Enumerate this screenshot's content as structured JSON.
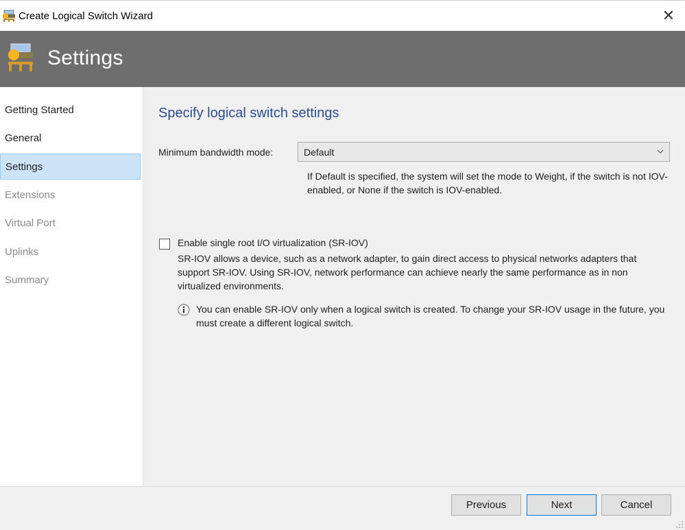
{
  "window": {
    "title": "Create Logical Switch Wizard"
  },
  "banner": {
    "title": "Settings"
  },
  "nav": {
    "items": [
      {
        "label": "Getting Started",
        "state": "done"
      },
      {
        "label": "General",
        "state": "done"
      },
      {
        "label": "Settings",
        "state": "active"
      },
      {
        "label": "Extensions",
        "state": "pending"
      },
      {
        "label": "Virtual Port",
        "state": "pending"
      },
      {
        "label": "Uplinks",
        "state": "pending"
      },
      {
        "label": "Summary",
        "state": "pending"
      }
    ]
  },
  "main": {
    "heading": "Specify logical switch settings",
    "bandwidth": {
      "label": "Minimum bandwidth mode:",
      "value": "Default",
      "help": "If Default is specified, the system will set the mode to Weight, if the switch is not IOV-enabled, or None if the switch is IOV-enabled."
    },
    "sriov": {
      "label": "Enable single root I/O virtualization (SR-IOV)",
      "checked": false,
      "description": "SR-IOV allows a device, such as a network adapter, to gain direct access to physical networks adapters that support SR-IOV. Using SR-IOV, network performance can achieve nearly the same performance as in non virtualized environments.",
      "info": "You can enable SR-IOV only when a logical switch is created. To change your SR-IOV usage in the future, you must create a different logical switch."
    }
  },
  "footer": {
    "previous_label": "Previous",
    "next_label": "Next",
    "cancel_label": "Cancel"
  },
  "colors": {
    "banner": "#6e6e6e",
    "heading": "#2a4d8e",
    "nav_active_bg": "#cce4f7",
    "nav_pending_text": "#8a8a8a",
    "panel_bg": "#f0f0f0"
  },
  "icons": {
    "title": "network-switch-icon",
    "banner": "network-switch-icon",
    "close": "close-icon",
    "dropdown": "chevron-down-icon",
    "info": "info-icon",
    "grip": "resize-grip-icon"
  }
}
